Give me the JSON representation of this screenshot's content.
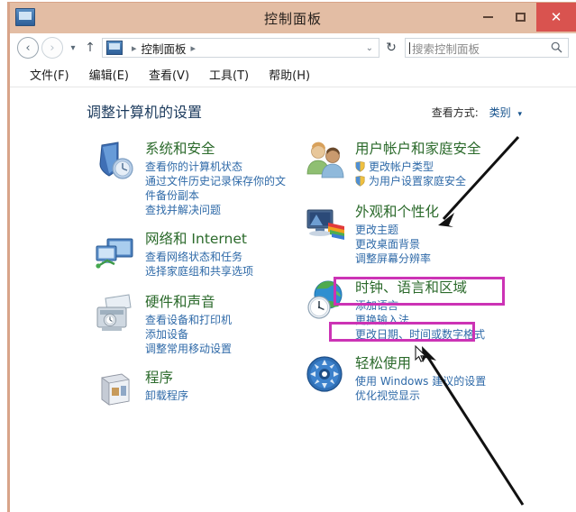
{
  "window": {
    "title": "控制面板",
    "icon": "control-panel-icon",
    "buttons": {
      "minimize": "−",
      "maximize": "□",
      "close": "✕"
    }
  },
  "addressbar": {
    "back": "‹",
    "forward": "›",
    "history": "▾",
    "up": "↑",
    "breadcrumb_icon": "control-panel-icon",
    "breadcrumb_sep1": "▸",
    "breadcrumb_text": "控制面板",
    "breadcrumb_sep2": "▸",
    "dropdown_caret": "⌄",
    "refresh": "↻",
    "search_placeholder": "搜索控制面板",
    "search_value": "",
    "search_icon": "search-icon"
  },
  "menubar": {
    "items": [
      "文件(F)",
      "编辑(E)",
      "查看(V)",
      "工具(T)",
      "帮助(H)"
    ]
  },
  "page": {
    "heading": "调整计算机的设置",
    "viewby_label": "查看方式:",
    "viewby_value": "类别",
    "viewby_caret": "▾"
  },
  "categories": {
    "left": [
      {
        "icon": "security-shield-icon",
        "title": "系统和安全",
        "links": [
          "查看你的计算机状态",
          "通过文件历史记录保存你的文件备份副本",
          "查找并解决问题"
        ]
      },
      {
        "icon": "network-monitor-icon",
        "title": "网络和 Internet",
        "links": [
          "查看网络状态和任务",
          "选择家庭组和共享选项"
        ]
      },
      {
        "icon": "printer-hardware-icon",
        "title": "硬件和声音",
        "links": [
          "查看设备和打印机",
          "添加设备",
          "调整常用移动设置"
        ]
      },
      {
        "icon": "programs-box-icon",
        "title": "程序",
        "links": [
          "卸载程序"
        ]
      }
    ],
    "right": [
      {
        "icon": "user-accounts-icon",
        "title": "用户帐户和家庭安全",
        "links": [
          "更改帐户类型",
          "为用户设置家庭安全"
        ],
        "link_shields": [
          true,
          true
        ]
      },
      {
        "icon": "appearance-palette-icon",
        "title": "外观和个性化",
        "links": [
          "更改主题",
          "更改桌面背景",
          "调整屏幕分辨率"
        ]
      },
      {
        "icon": "clock-globe-icon",
        "title": "时钟、语言和区域",
        "links": [
          "添加语言",
          "更换输入法",
          "更改日期、时间或数字格式"
        ]
      },
      {
        "icon": "ease-of-access-icon",
        "title": "轻松使用",
        "links": [
          "使用 Windows 建议的设置",
          "优化视觉显示"
        ]
      }
    ]
  },
  "annotations": {
    "highlight_color": "#cc33b5",
    "arrow_color": "#111111",
    "highlights": [
      {
        "name": "clock-language-region",
        "target": "时钟、语言和区域"
      },
      {
        "name": "change-input-method",
        "target": "更换输入法"
      }
    ],
    "arrows": [
      {
        "name": "arrow-to-appearance",
        "points_at": "外观和个性化"
      },
      {
        "name": "arrow-to-input-method",
        "points_at": "更换输入法"
      }
    ]
  },
  "colors": {
    "titlebar": "#e3bda4",
    "close_button": "#d9534f",
    "category_title": "#2b6a2b",
    "link": "#2f6aa8",
    "heading": "#1b3a5c"
  }
}
